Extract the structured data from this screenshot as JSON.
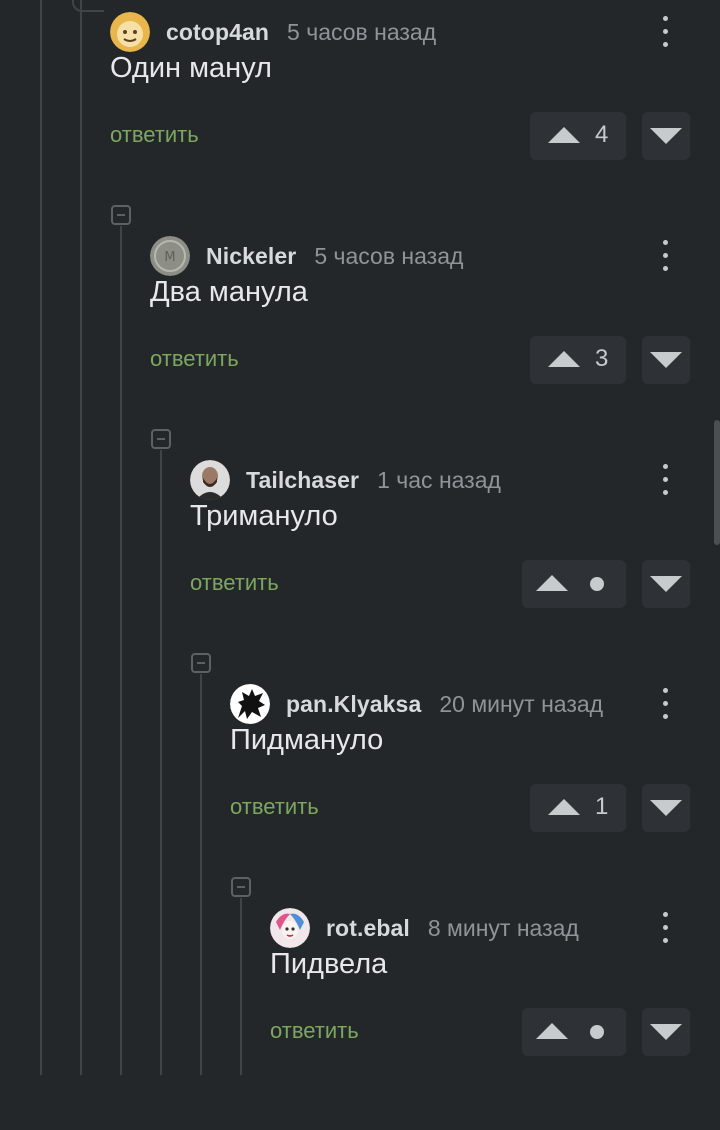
{
  "comments": [
    {
      "author": "cotop4an",
      "time": "5 часов назад",
      "text": "Один манул",
      "reply": "ответить",
      "votes": "4"
    },
    {
      "author": "Nickeler",
      "time": "5 часов назад",
      "text": "Два манула",
      "reply": "ответить",
      "votes": "3"
    },
    {
      "author": "Tailchaser",
      "time": "1 час назад",
      "text": "Тримануло",
      "reply": "ответить",
      "votes": null
    },
    {
      "author": "pan.Klyaksa",
      "time": "20 минут назад",
      "text": "Пидмануло",
      "reply": "ответить",
      "votes": "1"
    },
    {
      "author": "rot.ebal",
      "time": "8 минут назад",
      "text": "Пидвела",
      "reply": "ответить",
      "votes": null
    }
  ],
  "icons": {
    "upvote": "triangle-up-icon",
    "downvote": "triangle-down-icon",
    "more": "vertical-dots-icon",
    "collapse": "minus-box-icon"
  },
  "colors": {
    "background": "#24272a",
    "reply_link": "#7ba85d",
    "vote_bg": "#2e3236"
  }
}
